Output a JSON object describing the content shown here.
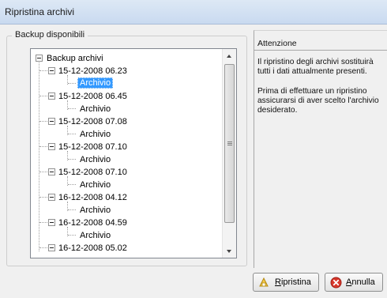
{
  "window": {
    "title": "Ripristina archivi"
  },
  "group": {
    "label": "Backup disponibili"
  },
  "tree": {
    "root": "Backup archivi",
    "items": [
      {
        "date": "15-12-2008 06.23",
        "child": "Archivio"
      },
      {
        "date": "15-12-2008 06.45",
        "child": "Archivio"
      },
      {
        "date": "15-12-2008 07.08",
        "child": "Archivio"
      },
      {
        "date": "15-12-2008 07.10",
        "child": "Archivio"
      },
      {
        "date": "15-12-2008 07.10",
        "child": "Archivio"
      },
      {
        "date": "16-12-2008 04.12",
        "child": "Archivio"
      },
      {
        "date": "16-12-2008 04.59",
        "child": "Archivio"
      },
      {
        "date": "16-12-2008 05.02"
      }
    ]
  },
  "attention": {
    "heading": "Attenzione",
    "paragraph1": "Il ripristino degli archivi  sostituirà tutti i dati attualmente presenti.",
    "paragraph2": "Prima di effettuare un ripristino assicurarsi di aver scelto l'archivio desiderato."
  },
  "buttons": {
    "restore": {
      "first": "R",
      "rest": "ipristina"
    },
    "cancel": {
      "first": "A",
      "rest": "nnulla"
    }
  }
}
